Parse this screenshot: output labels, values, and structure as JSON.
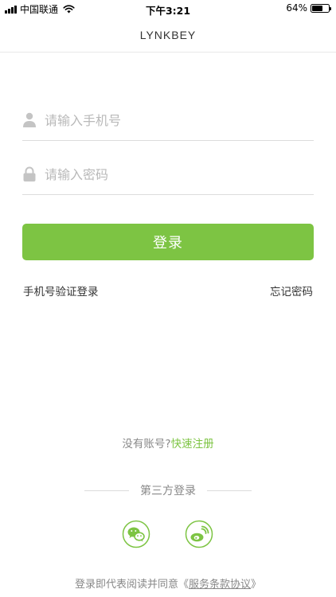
{
  "status_bar": {
    "carrier": "中国联通",
    "time": "下午3:21",
    "battery_text": "64%",
    "battery_level": 0.64
  },
  "nav": {
    "title": "LYNKBEY"
  },
  "form": {
    "phone_placeholder": "请输入手机号",
    "password_placeholder": "请输入密码",
    "login_label": "登录",
    "sms_login_label": "手机号验证登录",
    "forgot_label": "忘记密码"
  },
  "register": {
    "prompt": "没有账号?",
    "link": "快速注册"
  },
  "third_party": {
    "title": "第三方登录",
    "providers": [
      {
        "name": "wechat-icon"
      },
      {
        "name": "weibo-icon"
      }
    ]
  },
  "agreement": {
    "prefix": "登录即代表阅读并同意《",
    "link": "服务条款协议",
    "suffix": "》"
  },
  "colors": {
    "accent": "#7dc443",
    "placeholder": "#b9b9b9",
    "muted": "#888888"
  }
}
